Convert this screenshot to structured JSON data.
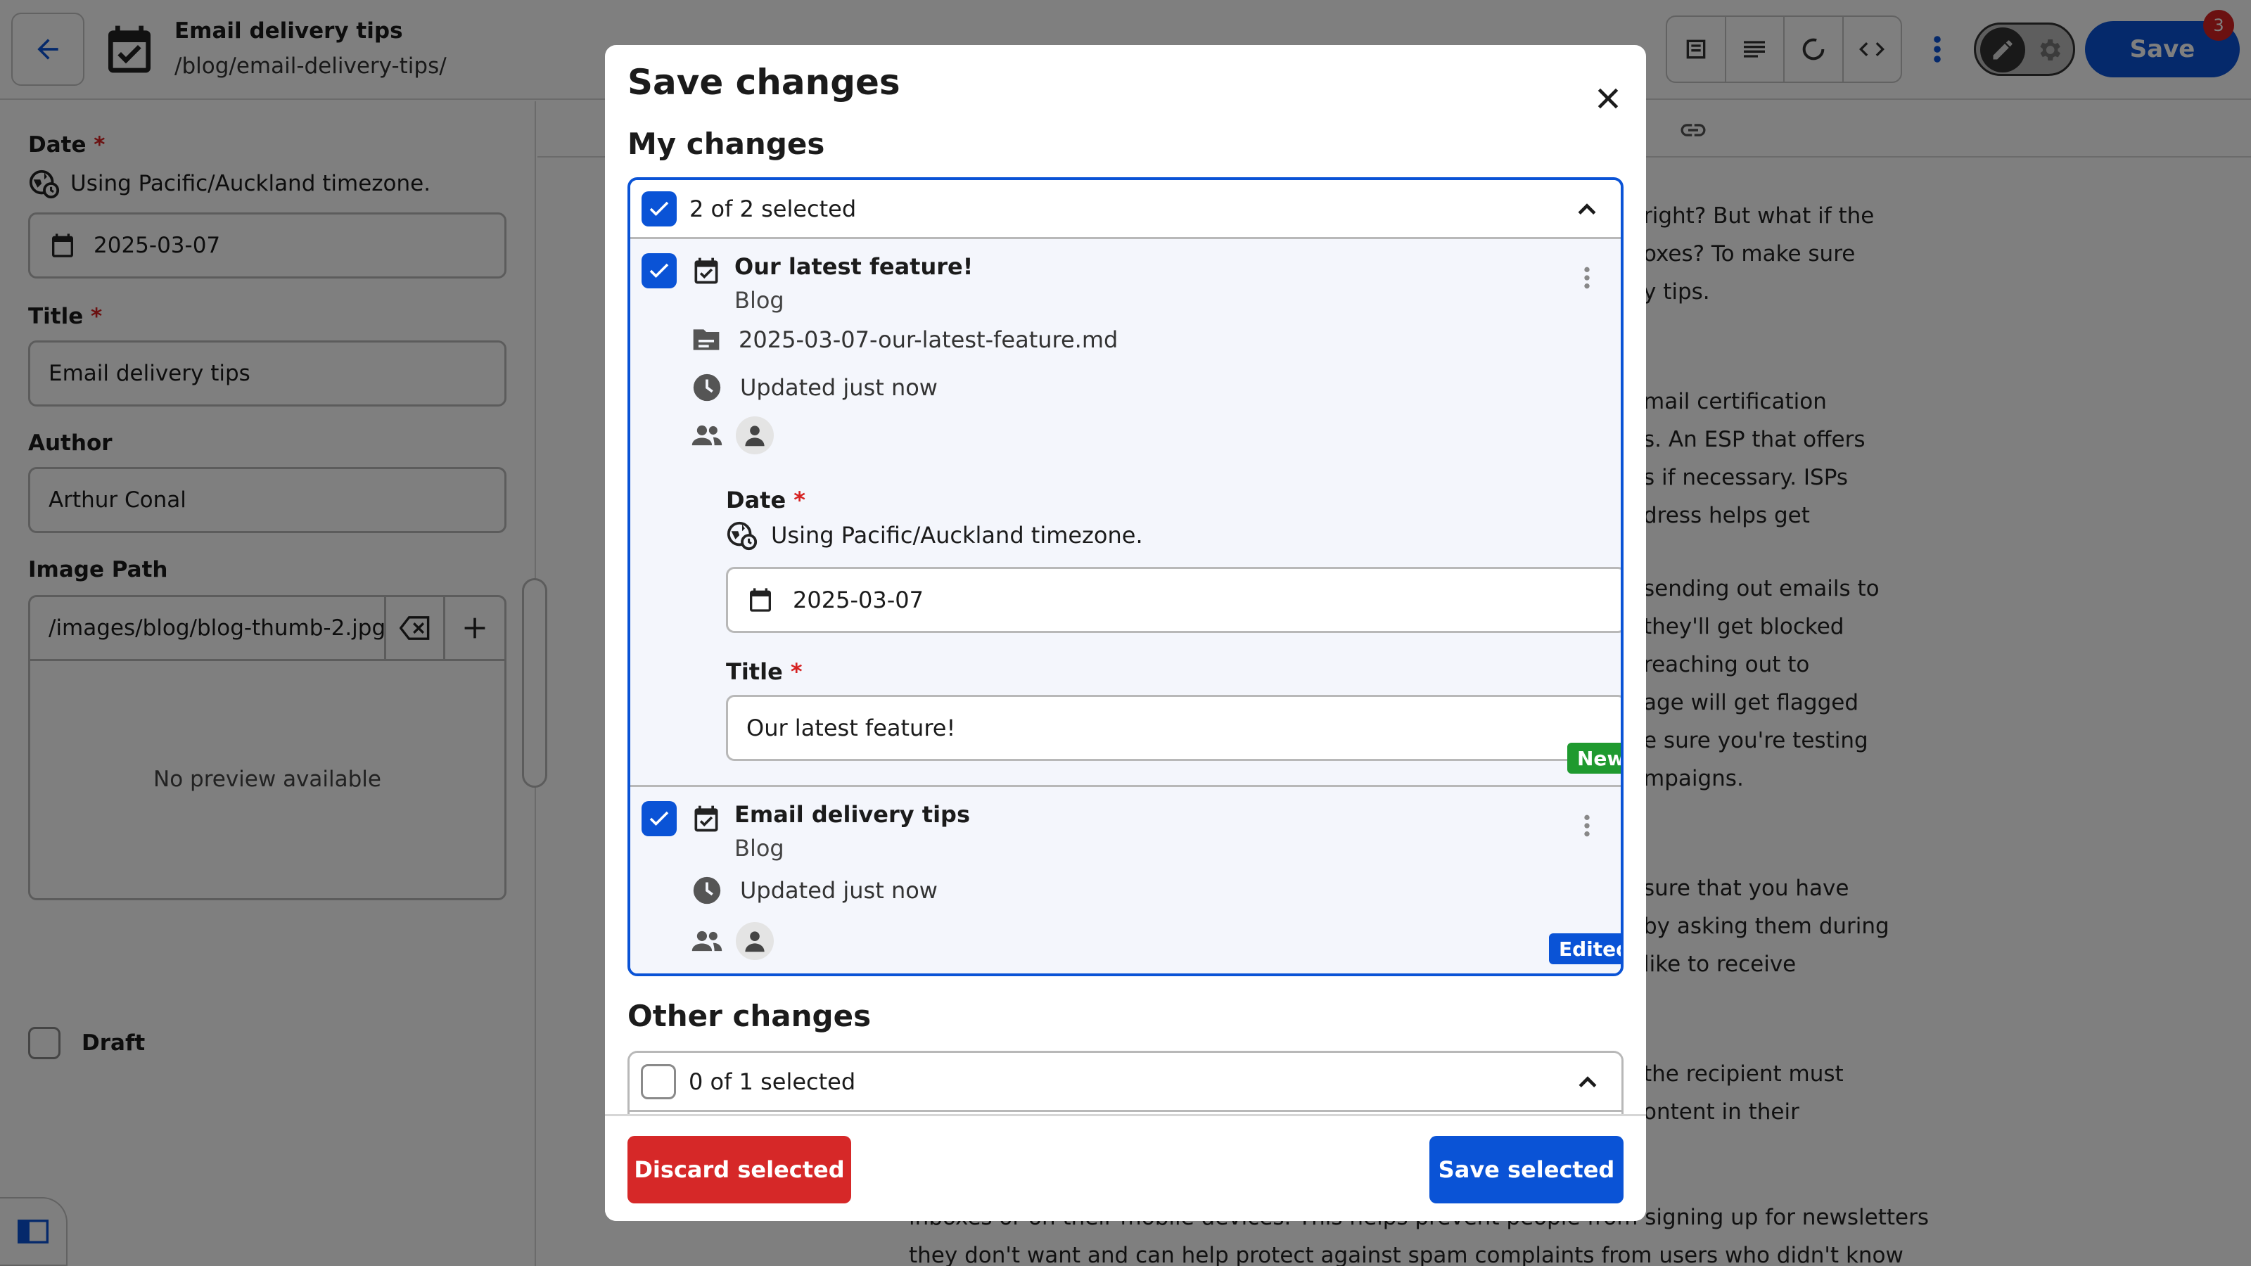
{
  "topbar": {
    "entry_title": "Email delivery tips",
    "entry_path": "/blog/email-delivery-tips/",
    "save_label": "Save",
    "save_badge": "3"
  },
  "sidebar": {
    "date_label": "Date",
    "timezone_text": "Using Pacific/Auckland timezone.",
    "date_value": "2025-03-07",
    "title_label": "Title",
    "title_value": "Email delivery tips",
    "author_label": "Author",
    "author_value": "Arthur Conal",
    "image_label": "Image Path",
    "image_value": "/images/blog/blog-thumb-2.jpg",
    "preview_text": "No preview available",
    "draft_label": "Draft",
    "required_mark": "*"
  },
  "editor": {
    "lines_top": [
      "right? But what if the",
      "oxes? To make sure",
      "y tips."
    ],
    "lines_2": [
      "mail certification",
      "s. An ESP that offers",
      "s if necessary. ISPs",
      "dress helps get"
    ],
    "lines_3": [
      "sending out emails to",
      "they'll get blocked",
      "reaching out to",
      "age will get flagged",
      "e sure you're testing",
      "mpaigns."
    ],
    "lines_4": [
      "sure that you have",
      "by asking them during",
      "like to receive"
    ],
    "lines_5": [
      "the recipient must",
      "ontent in their"
    ],
    "lines_bottom": [
      "inboxes or on their mobile devices. This helps prevent people from signing up for newsletters",
      "they don't want and can help protect against spam complaints from users who didn't know"
    ]
  },
  "modal": {
    "title": "Save changes",
    "my_changes_title": "My changes",
    "my_changes_summary": "2 of 2 selected",
    "other_changes_title": "Other changes",
    "other_changes_summary": "0 of 1 selected",
    "items": [
      {
        "title": "Our latest feature!",
        "collection": "Blog",
        "file": "2025-03-07-our-latest-feature.md",
        "updated": "Updated just now",
        "date_label": "Date",
        "timezone_text": "Using Pacific/Auckland timezone.",
        "date_value": "2025-03-07",
        "title_label": "Title",
        "title_value": "Our latest feature!",
        "tag": "New"
      },
      {
        "title": "Email delivery tips",
        "collection": "Blog",
        "updated": "Updated just now",
        "tag": "Edited"
      }
    ],
    "discard_label": "Discard selected",
    "save_label": "Save selected"
  },
  "colors": {
    "primary": "#0a53d6",
    "danger": "#d62828",
    "success": "#1f9a2f",
    "badge": "#d62222"
  }
}
